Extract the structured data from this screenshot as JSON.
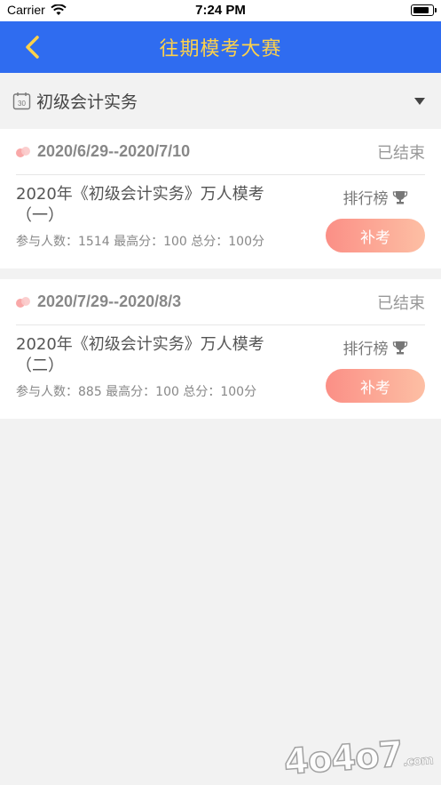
{
  "status_bar": {
    "carrier": "Carrier",
    "time": "7:24 PM"
  },
  "nav": {
    "title": "往期模考大赛",
    "back_icon": "chevron-left-icon"
  },
  "filter": {
    "subject": "初级会计实务",
    "icon": "calendar-icon",
    "calendar_day": "30"
  },
  "contests": [
    {
      "date_range": "2020/6/29--2020/7/10",
      "status": "已结束",
      "title": "2020年《初级会计实务》万人模考（一）",
      "stats": "参与人数：1514  最高分：100  总分：100分",
      "rank_label": "排行榜",
      "action_label": "补考"
    },
    {
      "date_range": "2020/7/29--2020/8/3",
      "status": "已结束",
      "title": "2020年《初级会计实务》万人模考（二）",
      "stats": "参与人数：885  最高分：100  总分：100分",
      "rank_label": "排行榜",
      "action_label": "补考"
    }
  ],
  "watermark": {
    "main": "4o4o7",
    "suffix": ".com"
  },
  "colors": {
    "nav_bg": "#2f6cf0",
    "nav_title": "#ffd24a",
    "button_start": "#fb8f86",
    "button_end": "#fdbfa4"
  }
}
